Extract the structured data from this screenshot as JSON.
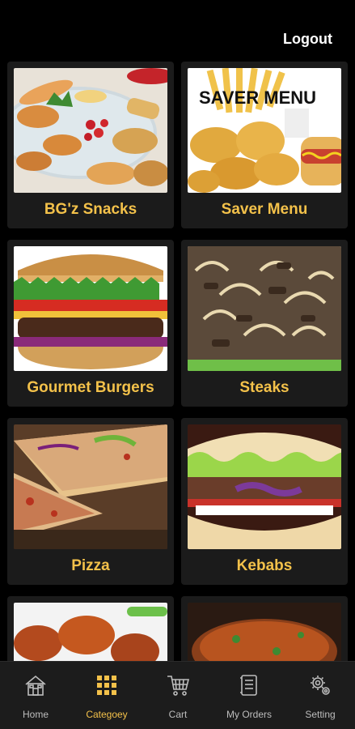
{
  "header": {
    "logout_label": "Logout"
  },
  "categories": [
    {
      "label": "BG'z Snacks"
    },
    {
      "label": "Saver Menu",
      "image_text": "SAVER MENU"
    },
    {
      "label": "Gourmet Burgers"
    },
    {
      "label": "Steaks"
    },
    {
      "label": "Pizza"
    },
    {
      "label": "Kebabs"
    }
  ],
  "nav": [
    {
      "label": "Home",
      "icon": "home-icon"
    },
    {
      "label": "Categoey",
      "icon": "grid-icon",
      "active": true
    },
    {
      "label": "Cart",
      "icon": "cart-icon"
    },
    {
      "label": "My Orders",
      "icon": "orders-icon"
    },
    {
      "label": "Setting",
      "icon": "gear-icon"
    }
  ],
  "colors": {
    "accent": "#f3c14a",
    "card": "#1b1b1b",
    "background": "#000000",
    "nav": "#1c1c1c"
  }
}
